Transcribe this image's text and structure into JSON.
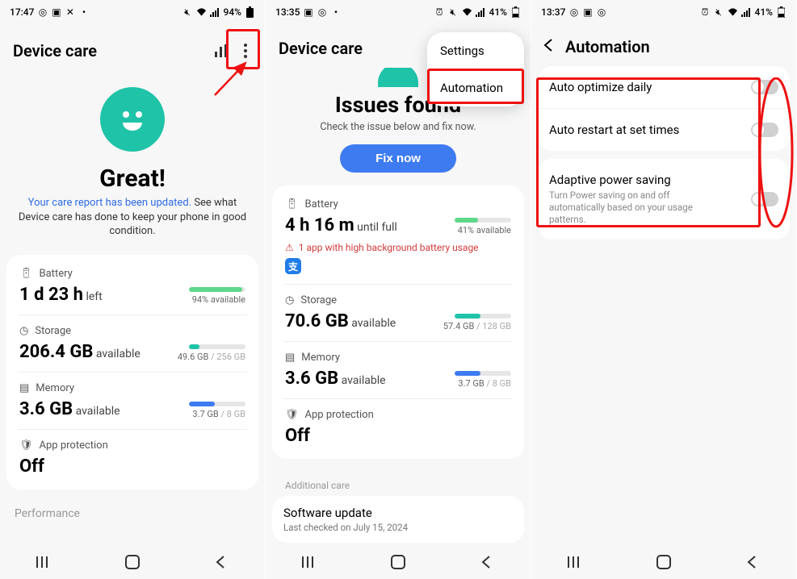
{
  "col1": {
    "status": {
      "time": "17:47",
      "battery": "94%"
    },
    "title": "Device care",
    "status_word": "Great!",
    "report_link": "Your care report has been updated.",
    "report_rest": " See what Device care has done to keep your phone in good condition.",
    "battery": {
      "label": "Battery",
      "value": "1 d 23 h",
      "unit": " left",
      "avail": "94% available",
      "pct": 94,
      "color": "#5fd78b"
    },
    "storage": {
      "label": "Storage",
      "value": "206.4 GB",
      "unit": " available",
      "used": "49.6 GB",
      "total": " / 256 GB",
      "pct": 19,
      "color": "#1fc3a8"
    },
    "memory": {
      "label": "Memory",
      "value": "3.6 GB",
      "unit": " available",
      "used": "3.7 GB",
      "total": " / 8 GB",
      "pct": 46,
      "color": "#3e7bf0"
    },
    "app_prot": {
      "label": "App protection",
      "value": "Off"
    },
    "performance": "Performance"
  },
  "col2": {
    "status": {
      "time": "13:35",
      "battery": "41%"
    },
    "title": "Device care",
    "issues_title": "Issues found",
    "issues_sub": "Check the issue below and fix now.",
    "fix_btn": "Fix now",
    "menu": {
      "settings": "Settings",
      "automation": "Automation"
    },
    "battery": {
      "label": "Battery",
      "value": "4 h 16 m",
      "unit": " until full",
      "avail": "41% available",
      "pct": 41,
      "color": "#5fd78b",
      "warn": "1 app with high background battery usage",
      "app": "支"
    },
    "storage": {
      "label": "Storage",
      "value": "70.6 GB",
      "unit": " available",
      "used": "57.4 GB",
      "total": " / 128 GB",
      "pct": 45,
      "color": "#1fc3a8"
    },
    "memory": {
      "label": "Memory",
      "value": "3.6 GB",
      "unit": " available",
      "used": "3.7 GB",
      "total": " / 8 GB",
      "pct": 46,
      "color": "#3e7bf0"
    },
    "app_prot": {
      "label": "App protection",
      "value": "Off"
    },
    "additional": "Additional care",
    "software": {
      "title": "Software update",
      "sub": "Last checked on July 15, 2024"
    }
  },
  "col3": {
    "status": {
      "time": "13:37",
      "battery": "41%"
    },
    "title": "Automation",
    "rows": [
      {
        "label": "Auto optimize daily",
        "sub": ""
      },
      {
        "label": "Auto restart at set times",
        "sub": ""
      },
      {
        "label": "Adaptive power saving",
        "sub": "Turn Power saving on and off automatically based on your usage patterns."
      }
    ]
  }
}
